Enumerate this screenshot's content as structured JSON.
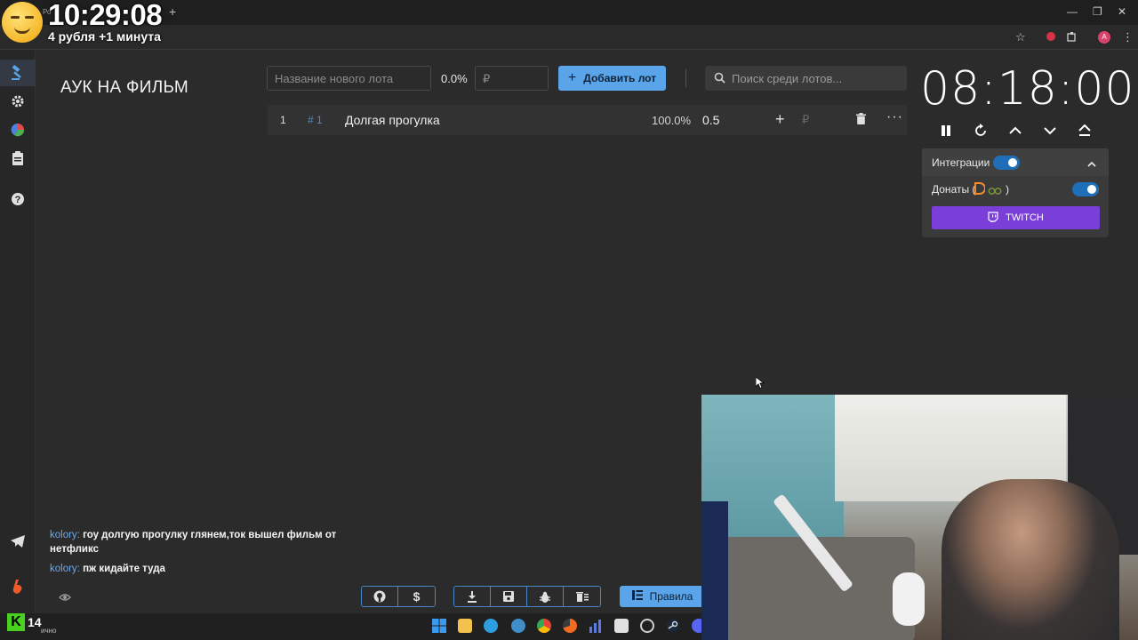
{
  "overlay": {
    "clock": "10:29:08",
    "rate_text": "4 рубля +1 минута"
  },
  "browser": {
    "tab_label_small": "Ро",
    "new_tab": "+"
  },
  "page": {
    "title": "АУК НА ФИЛЬМ"
  },
  "form": {
    "lot_name_placeholder": "Название нового лота",
    "percent": "0.0%",
    "amount_placeholder": "₽",
    "add_button": "Добавить лот",
    "search_placeholder": "Поиск среди лотов..."
  },
  "lots": [
    {
      "index": "1",
      "hash": "# 1",
      "name": "Долгая прогулка",
      "percent": "100.0%",
      "amount": "0.5",
      "add": "+",
      "currency": "₽",
      "more": "···"
    }
  ],
  "timer": {
    "value": "08:18:00"
  },
  "integrations": {
    "title": "Интеграции",
    "donations_label": "Донаты (",
    "donations_suffix": ")",
    "twitch_button": "TWITCH",
    "integrations_enabled": true,
    "donations_enabled": true
  },
  "chat": [
    {
      "user": "kolory:",
      "text": "гоу долгую прогулку глянем,ток вышел фильм от нетфликс"
    },
    {
      "user": "kolory:",
      "text": "пж кидайте туда"
    }
  ],
  "toolbar": {
    "rules_button": "Правила"
  },
  "taskbar": {
    "k_logo": "K",
    "k_count": "14",
    "k_caption": "ично"
  },
  "colors": {
    "accent_blue": "#5aa4ea",
    "twitch_purple": "#7a3fd8",
    "toggle_blue": "#1f6fb8",
    "chat_user": "#6aa8e8"
  }
}
